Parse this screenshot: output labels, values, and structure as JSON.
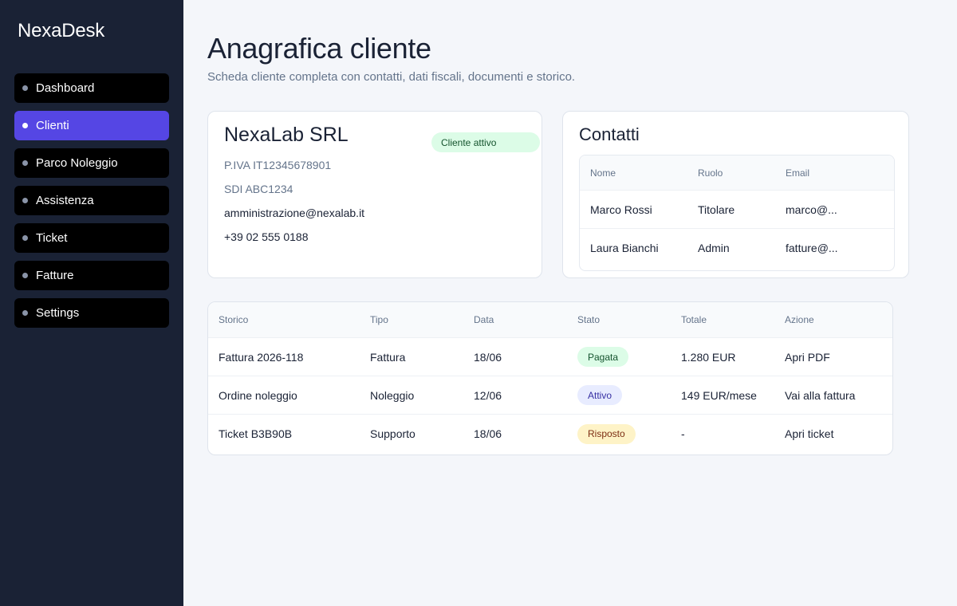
{
  "app": {
    "brand": "NexaDesk"
  },
  "sidebar": {
    "items": [
      {
        "label": "Dashboard",
        "active": false
      },
      {
        "label": "Clienti",
        "active": true
      },
      {
        "label": "Parco Noleggio",
        "active": false
      },
      {
        "label": "Assistenza",
        "active": false
      },
      {
        "label": "Ticket",
        "active": false
      },
      {
        "label": "Fatture",
        "active": false
      },
      {
        "label": "Settings",
        "active": false
      }
    ]
  },
  "page": {
    "title": "Anagrafica cliente",
    "subtitle": "Scheda cliente completa con contatti, dati fiscali, documenti e storico."
  },
  "client": {
    "name": "NexaLab SRL",
    "status": "Cliente attivo",
    "vat": "P.IVA IT12345678901",
    "sdi": "SDI ABC1234",
    "email": "amministrazione@nexalab.it",
    "phone": "+39 02 555 0188"
  },
  "contacts": {
    "title": "Contatti",
    "columns": [
      "Nome",
      "Ruolo",
      "Email"
    ],
    "rows": [
      {
        "name": "Marco Rossi",
        "role": "Titolare",
        "email": "marco@..."
      },
      {
        "name": "Laura Bianchi",
        "role": "Admin",
        "email": "fatture@..."
      }
    ]
  },
  "history": {
    "columns": [
      "Storico",
      "Tipo",
      "Data",
      "Stato",
      "Totale",
      "Azione"
    ],
    "rows": [
      {
        "item": "Fattura 2026-118",
        "type": "Fattura",
        "date": "18/06",
        "status": "Pagata",
        "total": "1.280 EUR",
        "action": "Apri PDF"
      },
      {
        "item": "Ordine noleggio",
        "type": "Noleggio",
        "date": "12/06",
        "status": "Attivo",
        "total": "149 EUR/mese",
        "action": "Vai alla fattura"
      },
      {
        "item": "Ticket B3B90B",
        "type": "Supporto",
        "date": "18/06",
        "status": "Risposto",
        "total": "-",
        "action": "Apri ticket"
      }
    ]
  },
  "colors": {
    "sidebar_bg": "#1a2235",
    "accent": "#5546e4",
    "badge_green": "#dcfce7",
    "badge_blue": "#e8ecff",
    "badge_yellow": "#fef3c7"
  }
}
